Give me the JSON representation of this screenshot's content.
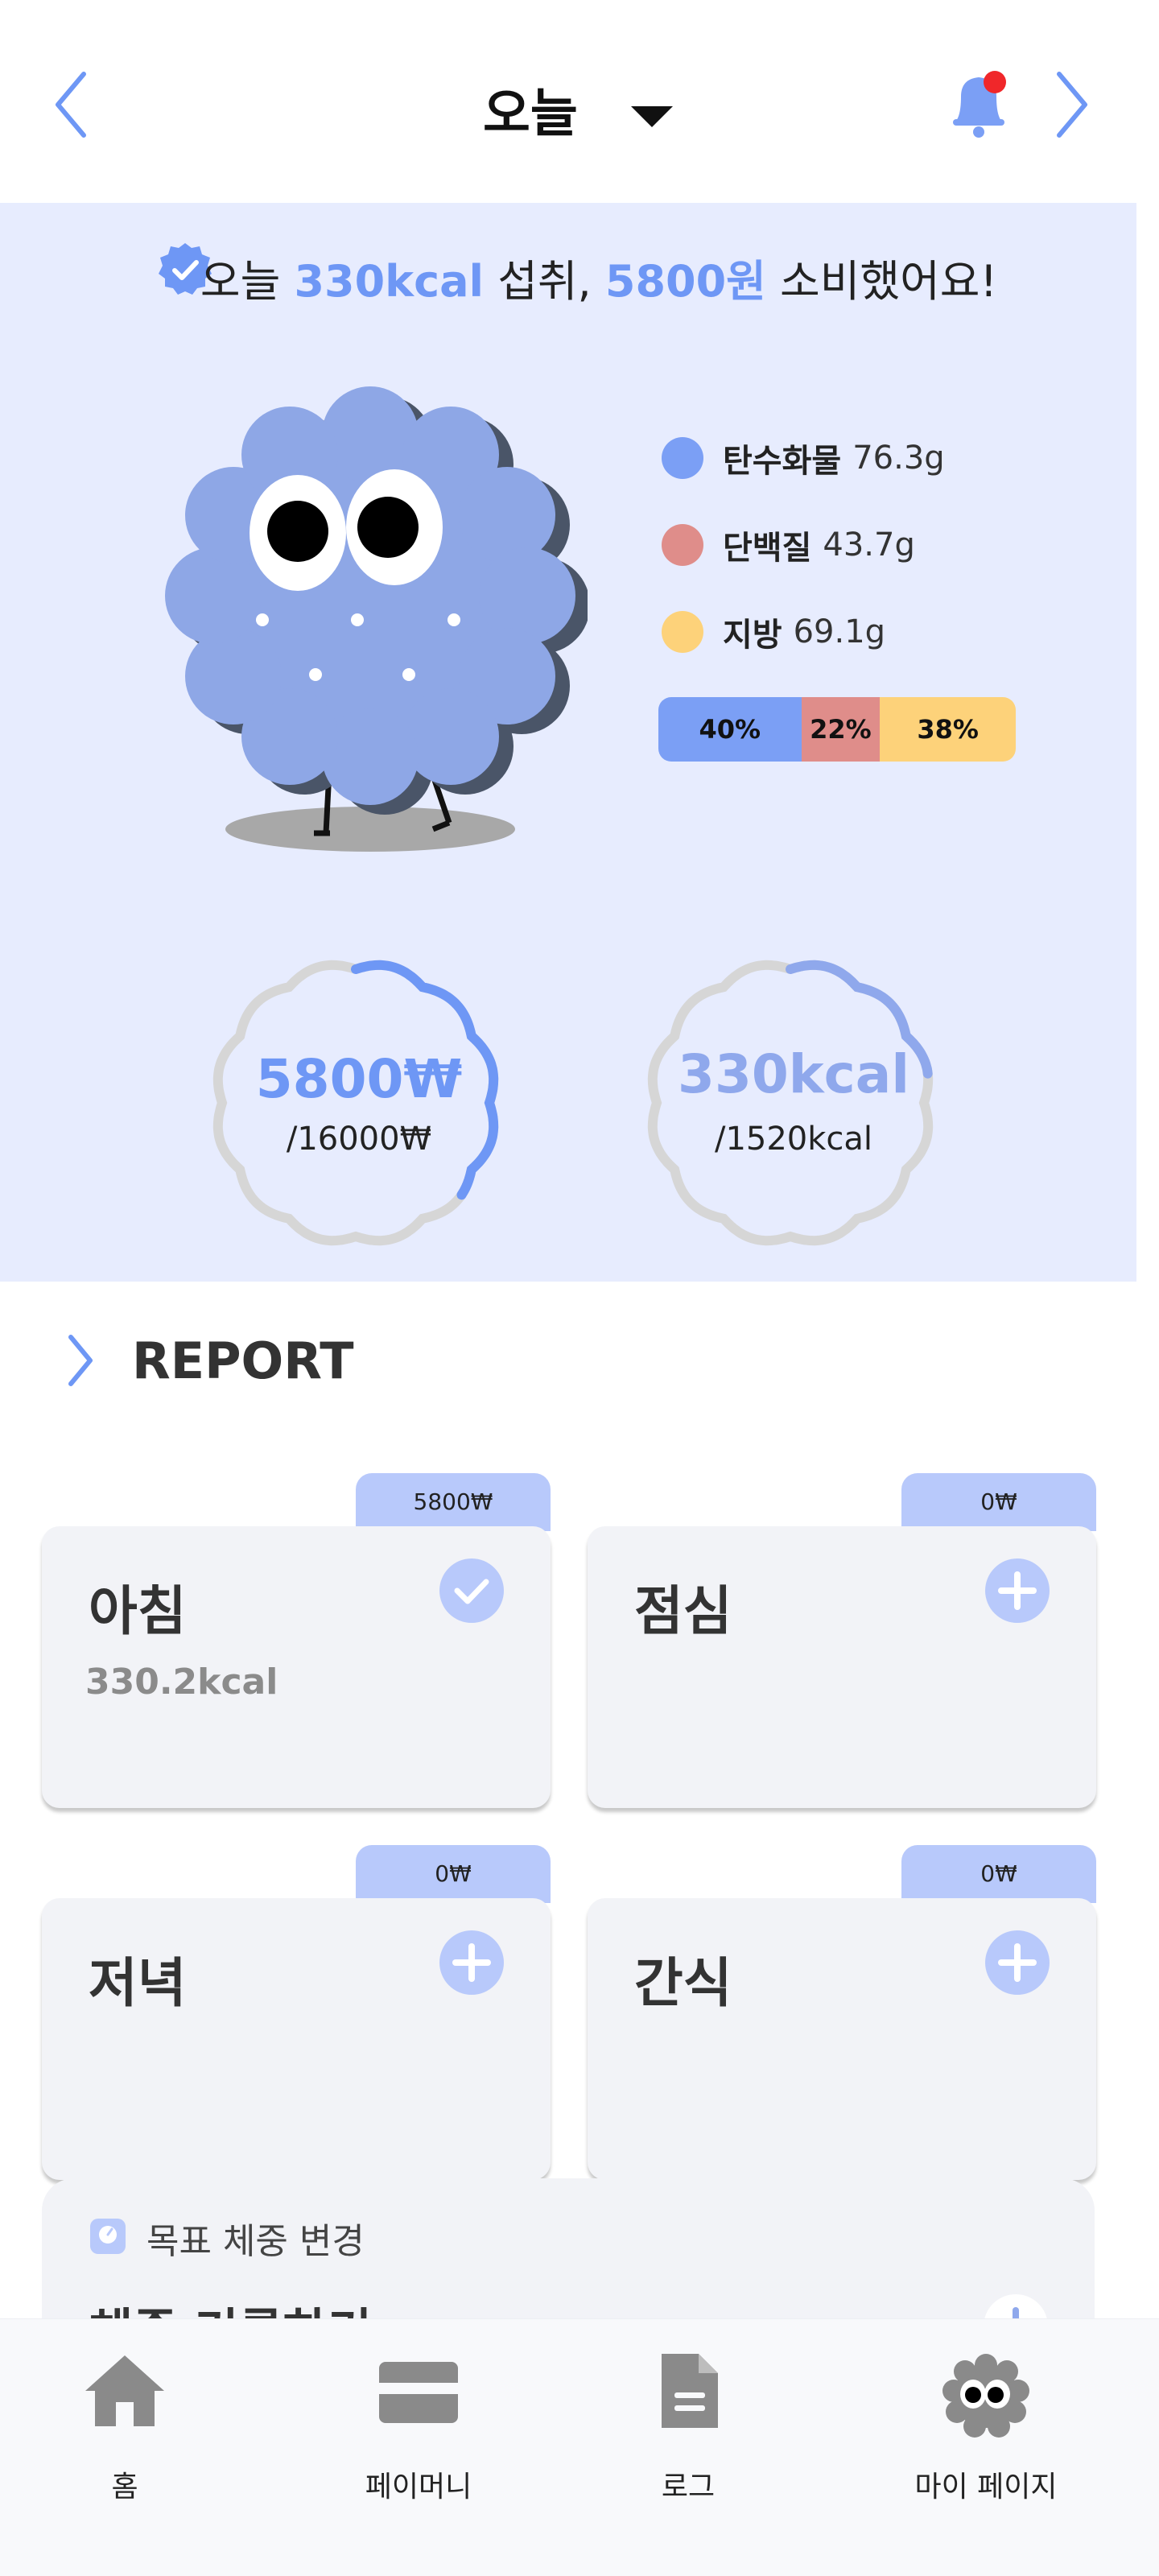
{
  "header": {
    "title": "오늘"
  },
  "summary": {
    "prefix": "오늘 ",
    "kcal": "330kcal",
    "middle": " 섭취, ",
    "won": "5800원",
    "suffix": " 소비했어요!"
  },
  "macros": [
    {
      "name": "탄수화물",
      "value": "76.3g",
      "color": "#7b9ff5"
    },
    {
      "name": "단백질",
      "value": "43.7g",
      "color": "#df8d8a"
    },
    {
      "name": "지방",
      "value": "69.1g",
      "color": "#fdd27a"
    }
  ],
  "ratio": [
    {
      "label": "40%",
      "percent": 40,
      "color": "#7b9ff5"
    },
    {
      "label": "22%",
      "percent": 22,
      "color": "#df8d8a"
    },
    {
      "label": "38%",
      "percent": 38,
      "color": "#fdd27a"
    }
  ],
  "budget_ring": {
    "value": "5800₩",
    "target": "/16000₩",
    "progress": 0.3625,
    "color": "#6e97f5"
  },
  "kcal_ring": {
    "value": "330kcal",
    "target": "/1520kcal",
    "progress": 0.217,
    "color": "#8fa8ec"
  },
  "report": {
    "title": "REPORT"
  },
  "meals": [
    {
      "name": "아침",
      "price": "5800₩",
      "kcal": "330.2kcal",
      "status": "check"
    },
    {
      "name": "점심",
      "price": "0₩",
      "kcal": "",
      "status": "add"
    },
    {
      "name": "저녁",
      "price": "0₩",
      "kcal": "",
      "status": "add"
    },
    {
      "name": "간식",
      "price": "0₩",
      "kcal": "",
      "status": "add"
    }
  ],
  "weight": {
    "label": "목표 체중 변경",
    "title": "체중 기록하기"
  },
  "nav": [
    {
      "label": "홈",
      "icon": "home-icon"
    },
    {
      "label": "페이머니",
      "icon": "card-icon"
    },
    {
      "label": "로그",
      "icon": "document-icon"
    },
    {
      "label": "마이 페이지",
      "icon": "mascot-icon"
    }
  ],
  "colors": {
    "accent": "#6e97f5",
    "panel": "#e7ecfe",
    "card": "#f2f3f7",
    "tab": "#b8c9fb",
    "notification": "#f0272a"
  }
}
